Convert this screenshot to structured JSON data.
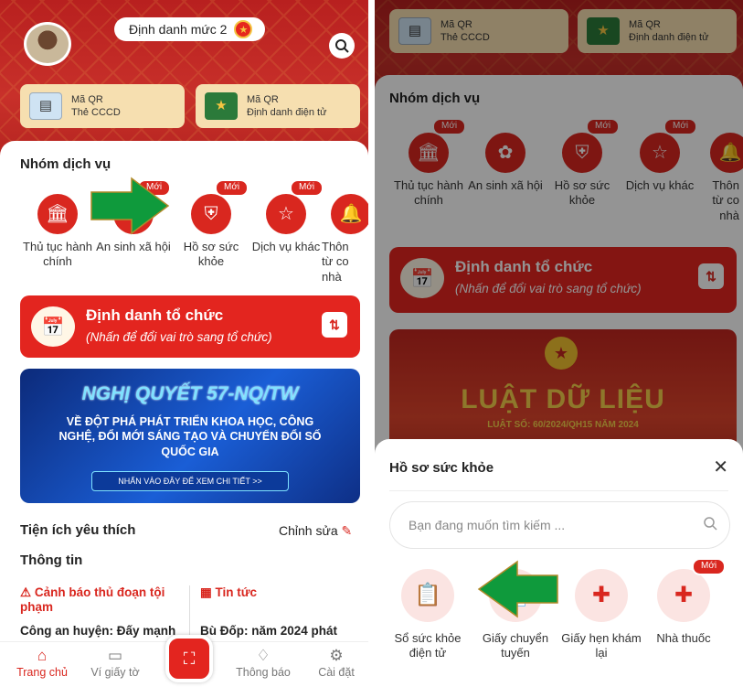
{
  "left": {
    "level_label": "Định danh mức 2",
    "qr_cards": [
      {
        "line1": "Mã QR",
        "line2": "Thẻ CCCD"
      },
      {
        "line1": "Mã QR",
        "line2": "Định danh điện tử"
      }
    ],
    "service_group_title": "Nhóm dịch vụ",
    "services": [
      {
        "label": "Thủ tục hành chính",
        "badge": ""
      },
      {
        "label": "An sinh xã hội",
        "badge": "Mới"
      },
      {
        "label": "Hồ sơ sức khỏe",
        "badge": "Mới"
      },
      {
        "label": "Dịch vụ khác",
        "badge": "Mới"
      },
      {
        "label": "Thôn từ co nhà",
        "badge": ""
      }
    ],
    "org_card": {
      "title": "Định danh tổ chức",
      "subtitle": "(Nhấn để đổi vai trò sang tổ chức)"
    },
    "banner": {
      "heading": "NGHỊ QUYẾT 57-NQ/TW",
      "body": "VỀ ĐỘT PHÁ PHÁT TRIỂN KHOA HỌC, CÔNG NGHỆ, ĐỔI MỚI SÁNG TẠO VÀ CHUYỂN ĐỔI SỐ QUỐC GIA",
      "cta": "NHẤN VÀO ĐÂY ĐỂ XEM CHI TIẾT >>"
    },
    "favorites_title": "Tiện ích yêu thích",
    "edit_label": "Chỉnh sửa",
    "info_title": "Thông tin",
    "news": [
      {
        "title": "Cảnh báo thủ đoạn tội phạm",
        "snippet": "Công an huyện: Đấy mạnh"
      },
      {
        "title": "Tin tức",
        "snippet": "Bù Đốp: năm 2024 phát"
      }
    ],
    "nav": [
      "Trang chủ",
      "Ví giấy tờ",
      "Thông báo",
      "Cài đặt"
    ]
  },
  "right": {
    "qr_cards": [
      {
        "line1": "Mã QR",
        "line2": "Thẻ CCCD"
      },
      {
        "line1": "Mã QR",
        "line2": "Định danh điện tử"
      }
    ],
    "service_group_title": "Nhóm dịch vụ",
    "services": [
      {
        "label": "Thủ tục hành chính",
        "badge": "Mới"
      },
      {
        "label": "An sinh xã hội",
        "badge": ""
      },
      {
        "label": "Hồ sơ sức khỏe",
        "badge": "Mới"
      },
      {
        "label": "Dịch vụ khác",
        "badge": "Mới"
      },
      {
        "label": "Thôn từ co nhà",
        "badge": ""
      }
    ],
    "org_card": {
      "title": "Định danh tổ chức",
      "subtitle": "(Nhấn để đổi vai trò sang tổ chức)"
    },
    "law_banner": {
      "title": "LUẬT DỮ LIỆU",
      "subtitle": "LUẬT SỐ: 60/2024/QH15 NĂM 2024"
    },
    "sheet": {
      "title": "Hồ sơ sức khỏe",
      "search_placeholder": "Bạn đang muốn tìm kiếm ...",
      "items": [
        {
          "label": "Sổ sức khỏe điện tử",
          "badge": ""
        },
        {
          "label": "Giấy chuyển tuyến",
          "badge": ""
        },
        {
          "label": "Giấy hẹn khám lại",
          "badge": ""
        },
        {
          "label": "Nhà thuốc",
          "badge": "Mới"
        }
      ]
    }
  },
  "colors": {
    "primary": "#e3251f",
    "arrow": "#0f9a3c",
    "card": "#f6dfb0"
  }
}
